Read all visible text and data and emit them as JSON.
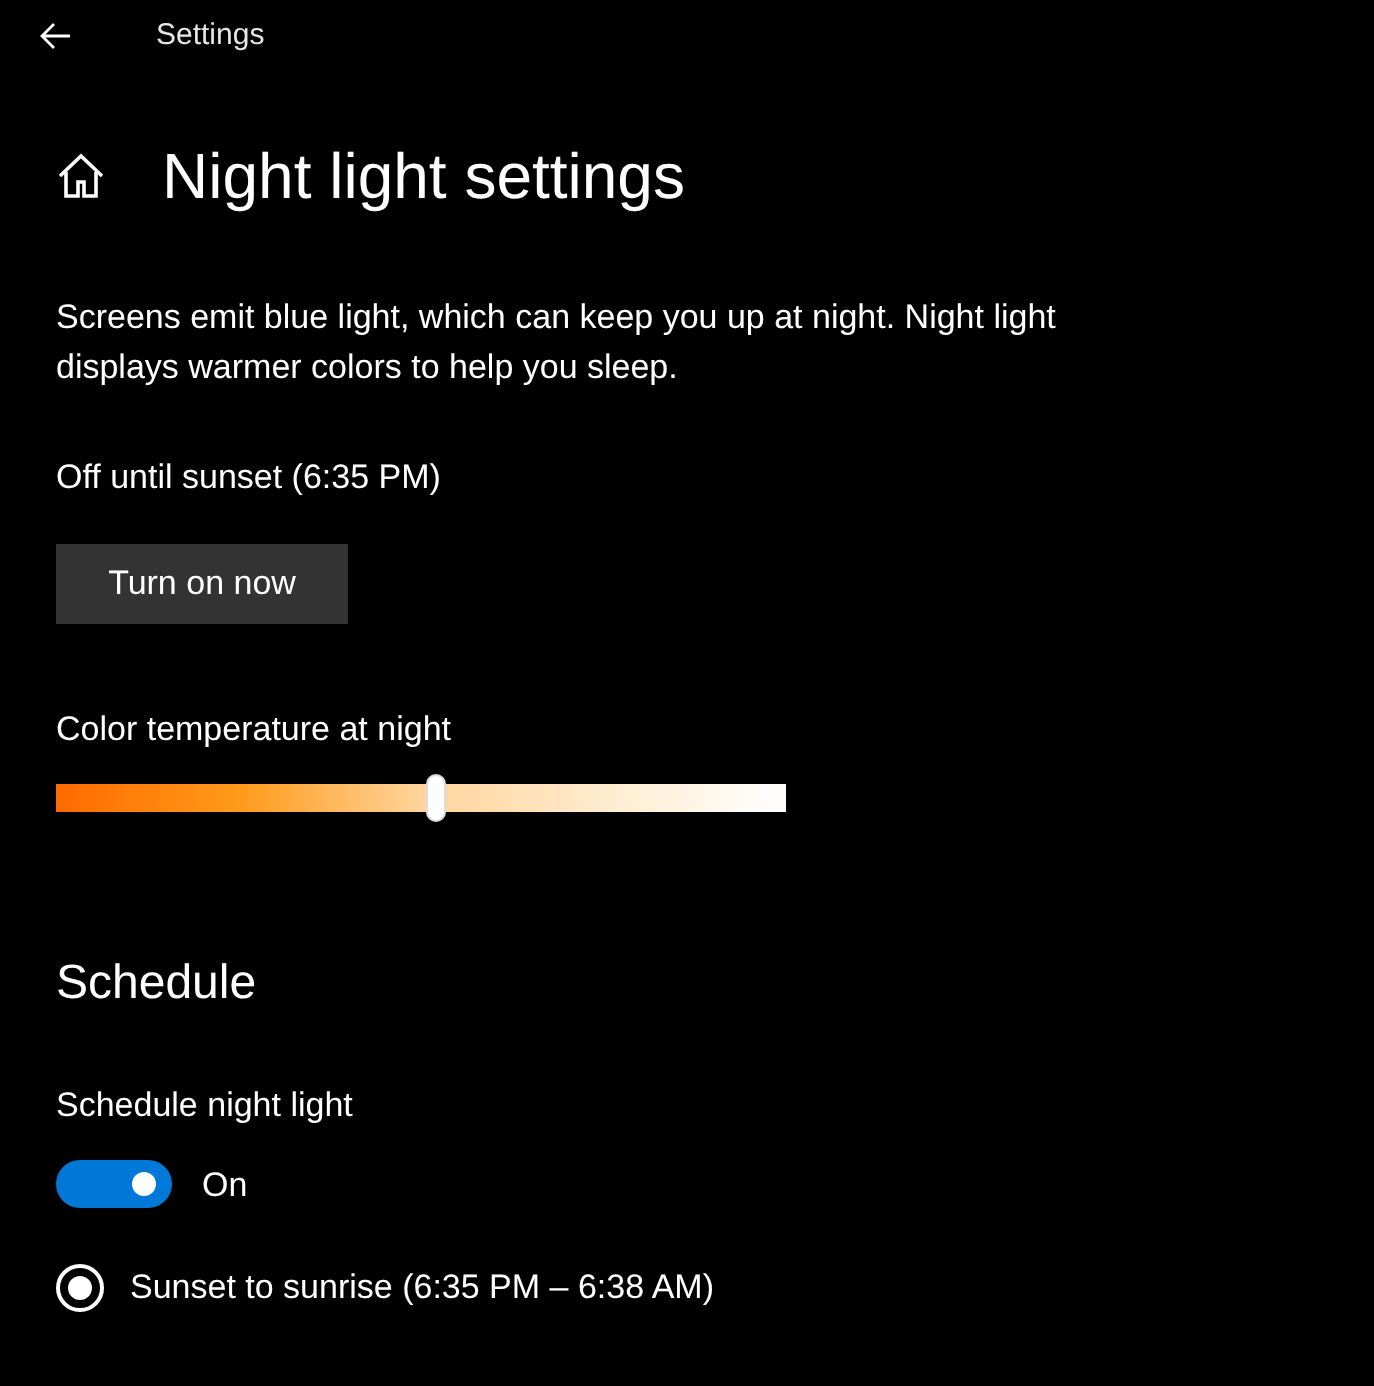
{
  "header": {
    "title": "Settings"
  },
  "page_title": "Night light settings",
  "description": "Screens emit blue light, which can keep you up at night. Night light displays warmer colors to help you sleep.",
  "status": "Off until sunset (6:35 PM)",
  "turn_on_button": "Turn on now",
  "color_temperature": {
    "label": "Color temperature at night",
    "level": 0.52
  },
  "schedule": {
    "heading": "Schedule",
    "toggle_label": "Schedule night light",
    "on": true,
    "state_text": "On",
    "options": [
      {
        "label": "Sunset to sunrise (6:35 PM – 6:38 AM)",
        "selected": true
      }
    ]
  }
}
